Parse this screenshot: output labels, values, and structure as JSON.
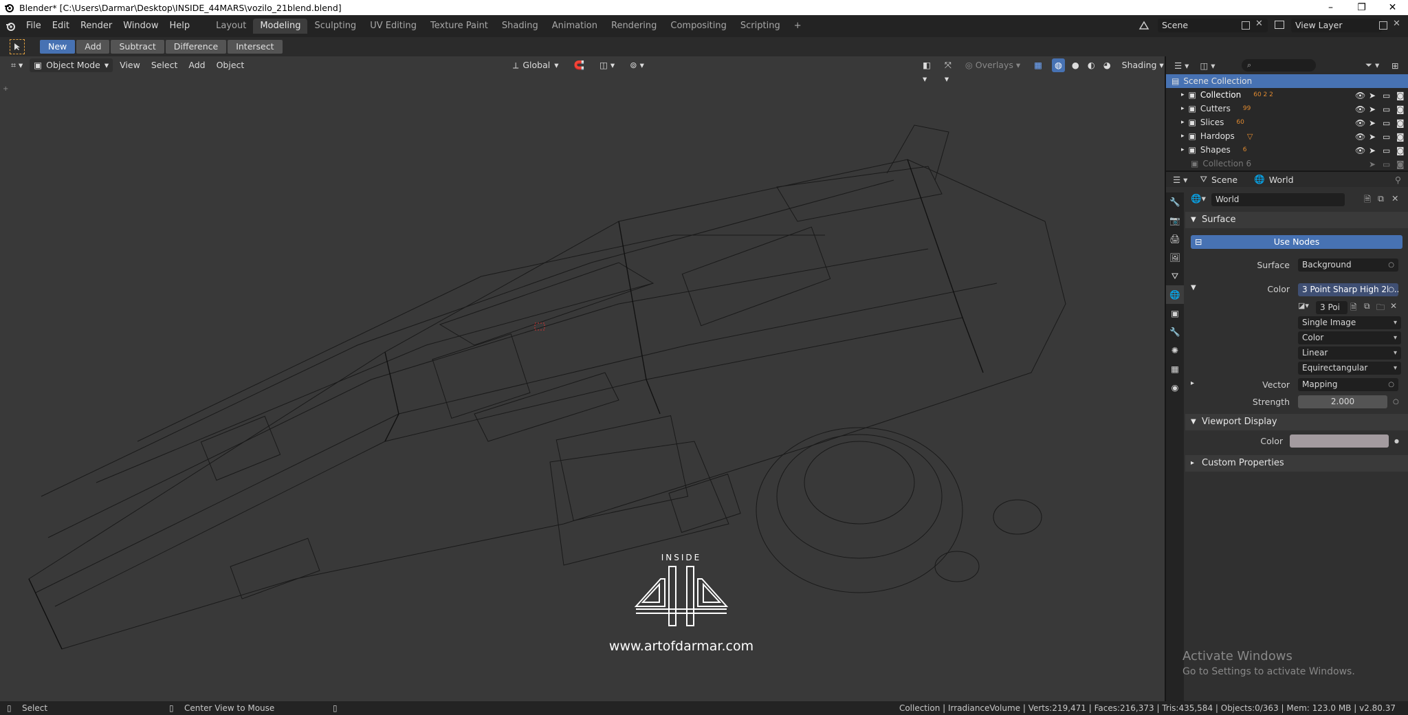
{
  "titlebar": {
    "title": "Blender* [C:\\Users\\Darmar\\Desktop\\INSIDE_44MARS\\vozilo_21blend.blend]",
    "minimize": "–",
    "maximize": "❐",
    "close": "✕"
  },
  "menu": [
    "File",
    "Edit",
    "Render",
    "Window",
    "Help"
  ],
  "workspaces": [
    "Layout",
    "Modeling",
    "Sculpting",
    "UV Editing",
    "Texture Paint",
    "Shading",
    "Animation",
    "Rendering",
    "Compositing",
    "Scripting"
  ],
  "active_workspace": "Modeling",
  "add_workspace": "+",
  "scene_name": "Scene",
  "view_layer": "View Layer",
  "bool_tools": [
    "New",
    "Add",
    "Subtract",
    "Difference",
    "Intersect"
  ],
  "viewport_header": {
    "mode": "Object Mode",
    "menus": [
      "View",
      "Select",
      "Add",
      "Object"
    ],
    "orientation": "Global",
    "overlays": "Overlays",
    "shading": "Shading"
  },
  "viewport_overlay": {
    "logo_text": "INSIDE",
    "url": "www.artofdarmar.com"
  },
  "outliner": {
    "root": "Scene Collection",
    "items": [
      {
        "name": "Collection",
        "badge": "60  2  2"
      },
      {
        "name": "Cutters",
        "badge": "99"
      },
      {
        "name": "Slices",
        "badge": "60"
      },
      {
        "name": "Hardops",
        "badge": ""
      },
      {
        "name": "Shapes",
        "badge": "6"
      },
      {
        "name": "Collection 6",
        "badge": ""
      }
    ]
  },
  "properties": {
    "crumb_scene": "Scene",
    "crumb_world": "World",
    "world_name": "World",
    "surface_panel": "Surface",
    "use_nodes": "Use Nodes",
    "surface_label": "Surface",
    "surface_value": "Background",
    "color_label": "Color",
    "color_value": "3 Point Sharp High 2k...",
    "image_short": "3 Poi",
    "image_source": "Single Image",
    "color_space": "Color",
    "interpolation": "Linear",
    "projection": "Equirectangular",
    "vector_label": "Vector",
    "vector_value": "Mapping",
    "strength_label": "Strength",
    "strength_value": "2.000",
    "viewport_display_panel": "Viewport Display",
    "vd_color_label": "Color",
    "vd_color_swatch": "#a39b9f",
    "custom_props_panel": "Custom Properties"
  },
  "watermark": {
    "line1": "Activate Windows",
    "line2": "Go to Settings to activate Windows."
  },
  "statusbar": {
    "left1": "Select",
    "left2": "Center View to Mouse",
    "right": "Collection | IrradianceVolume | Verts:219,471 | Faces:216,373 | Tris:435,584 | Objects:0/363 | Mem: 123.0 MB | v2.80.37"
  },
  "colors": {
    "accent": "#4772b3",
    "bg": "#393939",
    "header": "#232323",
    "wire": "#101010"
  }
}
